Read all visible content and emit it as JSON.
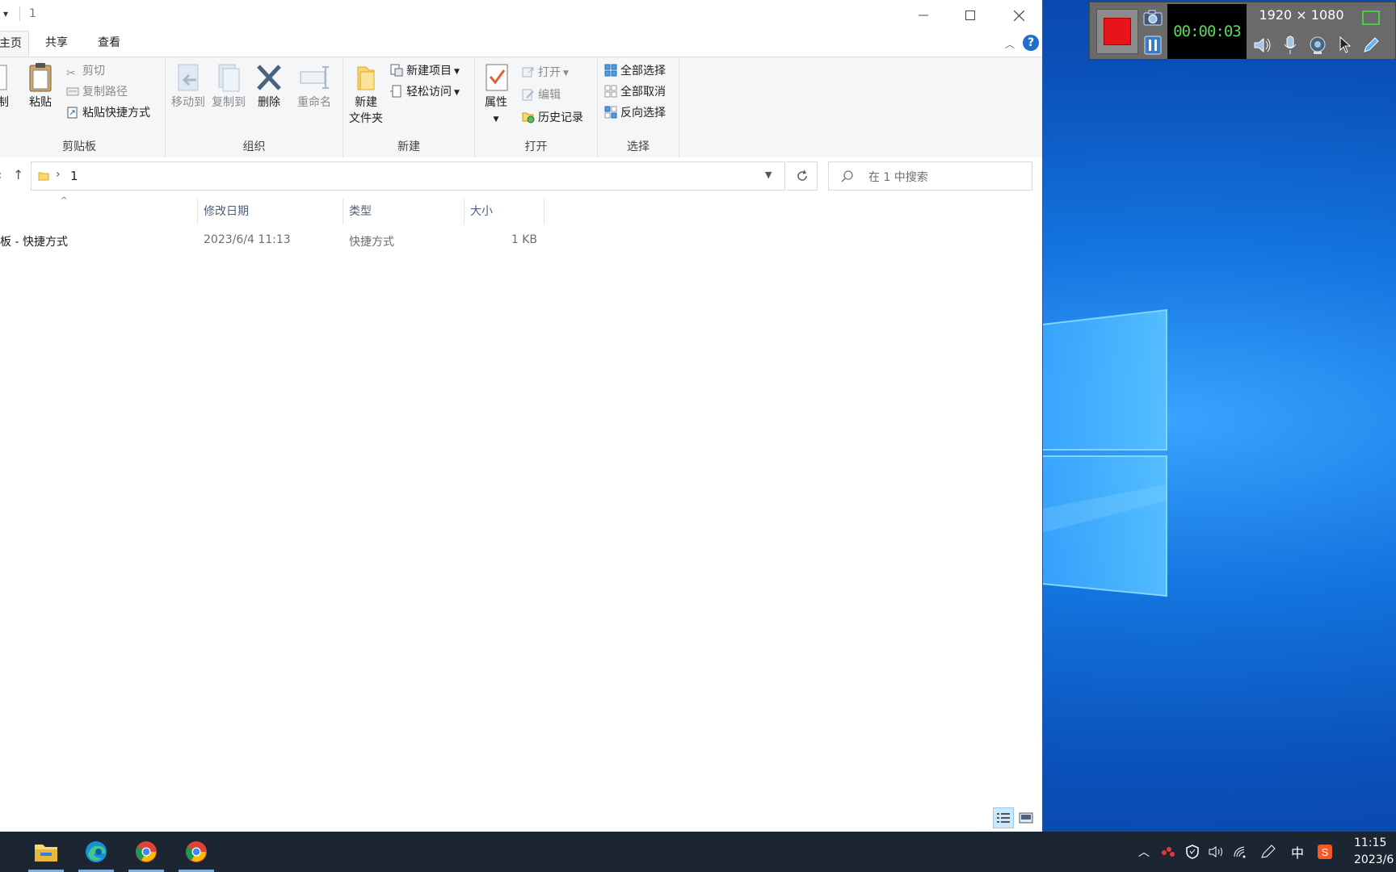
{
  "window": {
    "title": "1",
    "qat_icon": "▾",
    "controls": [
      "minimize-icon",
      "maximize-icon",
      "close-icon"
    ]
  },
  "tabs": [
    {
      "label": "主页",
      "visible_label": "主页",
      "active": true
    },
    {
      "label": "共享",
      "active": false
    },
    {
      "label": "查看",
      "active": false
    }
  ],
  "ribbon": {
    "clipboard": {
      "label": "剪贴板",
      "copy_partial": "制",
      "paste": "粘贴",
      "cut": "剪切",
      "copy_path": "复制路径",
      "paste_shortcut": "粘贴快捷方式"
    },
    "organize": {
      "label": "组织",
      "move_to": "移动到",
      "copy_to": "复制到",
      "delete": "删除",
      "rename": "重命名"
    },
    "new": {
      "label": "新建",
      "new_folder_line1": "新建",
      "new_folder_line2": "文件夹",
      "new_item": "新建项目",
      "easy_access": "轻松访问"
    },
    "open": {
      "label": "打开",
      "properties": "属性",
      "open": "打开",
      "edit": "编辑",
      "history": "历史记录"
    },
    "select": {
      "label": "选择",
      "select_all": "全部选择",
      "select_none": "全部取消",
      "invert": "反向选择"
    }
  },
  "address": {
    "path": "1",
    "search_placeholder": "在 1 中搜索"
  },
  "columns": {
    "modified": "修改日期",
    "type": "类型",
    "size": "大小"
  },
  "files": [
    {
      "name": "板 - 快捷方式",
      "modified": "2023/6/4 11:13",
      "type": "快捷方式",
      "size": "1 KB"
    }
  ],
  "recorder": {
    "timer": "00:00:03",
    "resolution": "1920 × 1080",
    "record_color": "#e8141a"
  },
  "taskbar": {
    "apps": [
      "file-explorer-icon",
      "edge-icon",
      "chrome-icon",
      "chrome-icon"
    ],
    "ime": "中",
    "time": "11:15",
    "date": "2023/6"
  },
  "colors": {
    "accent": "#1e6fd0",
    "taskbar": "#1c2633",
    "desktop": "#0a4fb8"
  }
}
